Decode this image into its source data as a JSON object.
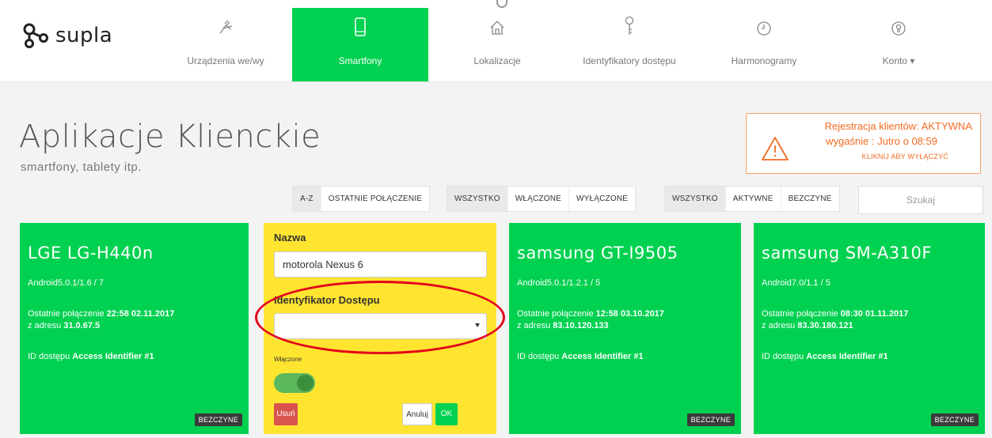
{
  "brand": {
    "name": "supla"
  },
  "nav": [
    {
      "label": "Urządzenia we/wy",
      "icon": "plug-icon",
      "active": false
    },
    {
      "label": "Smartfony",
      "icon": "smartphone-icon",
      "active": true
    },
    {
      "label": "Lokalizacje",
      "icon": "home-icon",
      "active": false
    },
    {
      "label": "Identyfikatory dostępu",
      "icon": "key-icon",
      "active": false
    },
    {
      "label": "Harmonogramy",
      "icon": "clock-icon",
      "active": false
    },
    {
      "label": "Konto ▾",
      "icon": "user-icon",
      "active": false
    }
  ],
  "header": {
    "title": "Aplikacje Klienckie",
    "subtitle": "smartfony, tablety itp."
  },
  "registration": {
    "line1": "Rejestracja klientów: AKTYWNA",
    "line2": "wygaśnie : Jutro o 08:59",
    "line3": "KLIKNIJ ABY WYŁĄCZYĆ",
    "accent": "#f26b21"
  },
  "filters": {
    "sort": [
      "A-Z",
      "OSTATNIE POŁĄCZENIE"
    ],
    "state": [
      "WSZYSTKO",
      "WŁĄCZONE",
      "WYŁĄCZONE"
    ],
    "activity": [
      "WSZYSTKO",
      "AKTYWNE",
      "BEZCZYNE"
    ]
  },
  "search": {
    "placeholder": "Szukaj"
  },
  "cards": [
    {
      "name": "LGE LG-H440n",
      "version": "Android5.0.1/1.6 / 7",
      "conn_prefix": "Ostatnie połączenie ",
      "conn_time": "22:58 02.11.2017",
      "addr_prefix": "z adresu ",
      "addr": "31.0.67.5",
      "acc_prefix": "ID dostępu ",
      "acc": "Access Identifier #1",
      "badge": "BEZCZYNE"
    },
    {
      "name": "samsung GT-I9505",
      "version": "Android5.0.1/1.2.1 / 5",
      "conn_prefix": "Ostatnie połączenie ",
      "conn_time": "12:58 03.10.2017",
      "addr_prefix": "z adresu ",
      "addr": "83.10.120.133",
      "acc_prefix": "ID dostępu ",
      "acc": "Access Identifier #1",
      "badge": "BEZCZYNE"
    },
    {
      "name": "samsung SM-A310F",
      "version": "Android7.0/1.1 / 5",
      "conn_prefix": "Ostatnie połączenie ",
      "conn_time": "08:30 01.11.2017",
      "addr_prefix": "z adresu ",
      "addr": "83.30.180.121",
      "acc_prefix": "ID dostępu ",
      "acc": "Access Identifier #1",
      "badge": "BEZCZYNE"
    }
  ],
  "edit": {
    "name_label": "Nazwa",
    "name_value": "motorola Nexus 6",
    "access_label": "Identyfikator Dostępu",
    "access_value": "",
    "enabled_label": "Włączone",
    "enabled": true,
    "delete_label": "Usuń",
    "cancel_label": "Anuluj",
    "ok_label": "OK"
  },
  "colors": {
    "green": "#00d150",
    "yellow": "#ffe530",
    "danger": "#d9534f",
    "annotation": "#e3001b"
  }
}
